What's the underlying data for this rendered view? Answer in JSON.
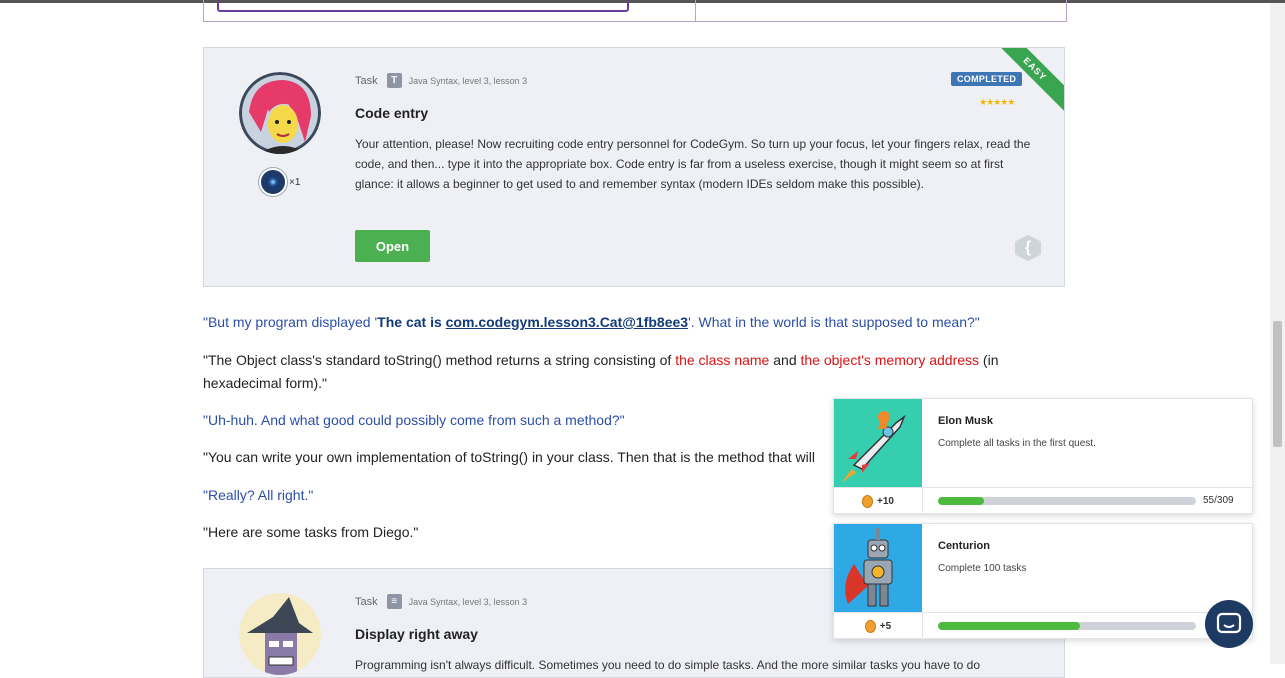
{
  "task1": {
    "task_label": "Task",
    "type_icon": "T",
    "breadcrumb": "Java Syntax,  level 3,  lesson 3",
    "title": "Code entry",
    "description": "Your attention, please! Now recruiting code entry personnel for CodeGym. So turn up your focus, let your fingers relax, read the code, and then... type it into the appropriate box. Code entry is far from a useless exercise, though it might seem so at first glance: it allows a beginner to get used to and remember syntax (modern IDEs seldom make this possible).",
    "open_label": "Open",
    "status": "COMPLETED",
    "stars": "★★★★★",
    "difficulty": "EASY",
    "badge_count": "×1"
  },
  "dialogue": {
    "p1_a": "\"But my program displayed '",
    "p1_bold": "The cat is ",
    "p1_link": "com.codegym.lesson3.Cat@1fb8ee3",
    "p1_b": "'. What in the world is that supposed to mean?\"",
    "p2_a": "\"The Object class's standard toString() method returns a string consisting of ",
    "p2_red1": "the class name",
    "p2_b": " and ",
    "p2_red2": "the object's memory address",
    "p2_c": " (in hexadecimal form).\"",
    "p3": "\"Uh-huh. And what good could possibly come from such a method?\"",
    "p4": "\"You can write your own implementation of toString() in your class. Then that is the method that will",
    "p5": "\"Really? All right.\"",
    "p6": "\"Here are some tasks from Diego.\""
  },
  "task2": {
    "task_label": "Task",
    "breadcrumb": "Java Syntax,  level 3,  lesson 3",
    "title": "Display right away",
    "description": "Programming isn't always difficult. Sometimes you need to do simple tasks. And the more similar tasks you have to do"
  },
  "achievements": [
    {
      "name": "Elon Musk",
      "description": "Complete all tasks in the first quest.",
      "points": "+10",
      "progress": 0.178,
      "count": "55/309"
    },
    {
      "name": "Centurion",
      "description": "Complete 100 tasks",
      "points": "+5",
      "progress": 0.55,
      "count": ""
    }
  ],
  "colors": {
    "accent_green": "#4caf50",
    "link_blue": "#2b4fa8",
    "highlight_red": "#dd1111",
    "status_blue": "#3e75b5"
  }
}
